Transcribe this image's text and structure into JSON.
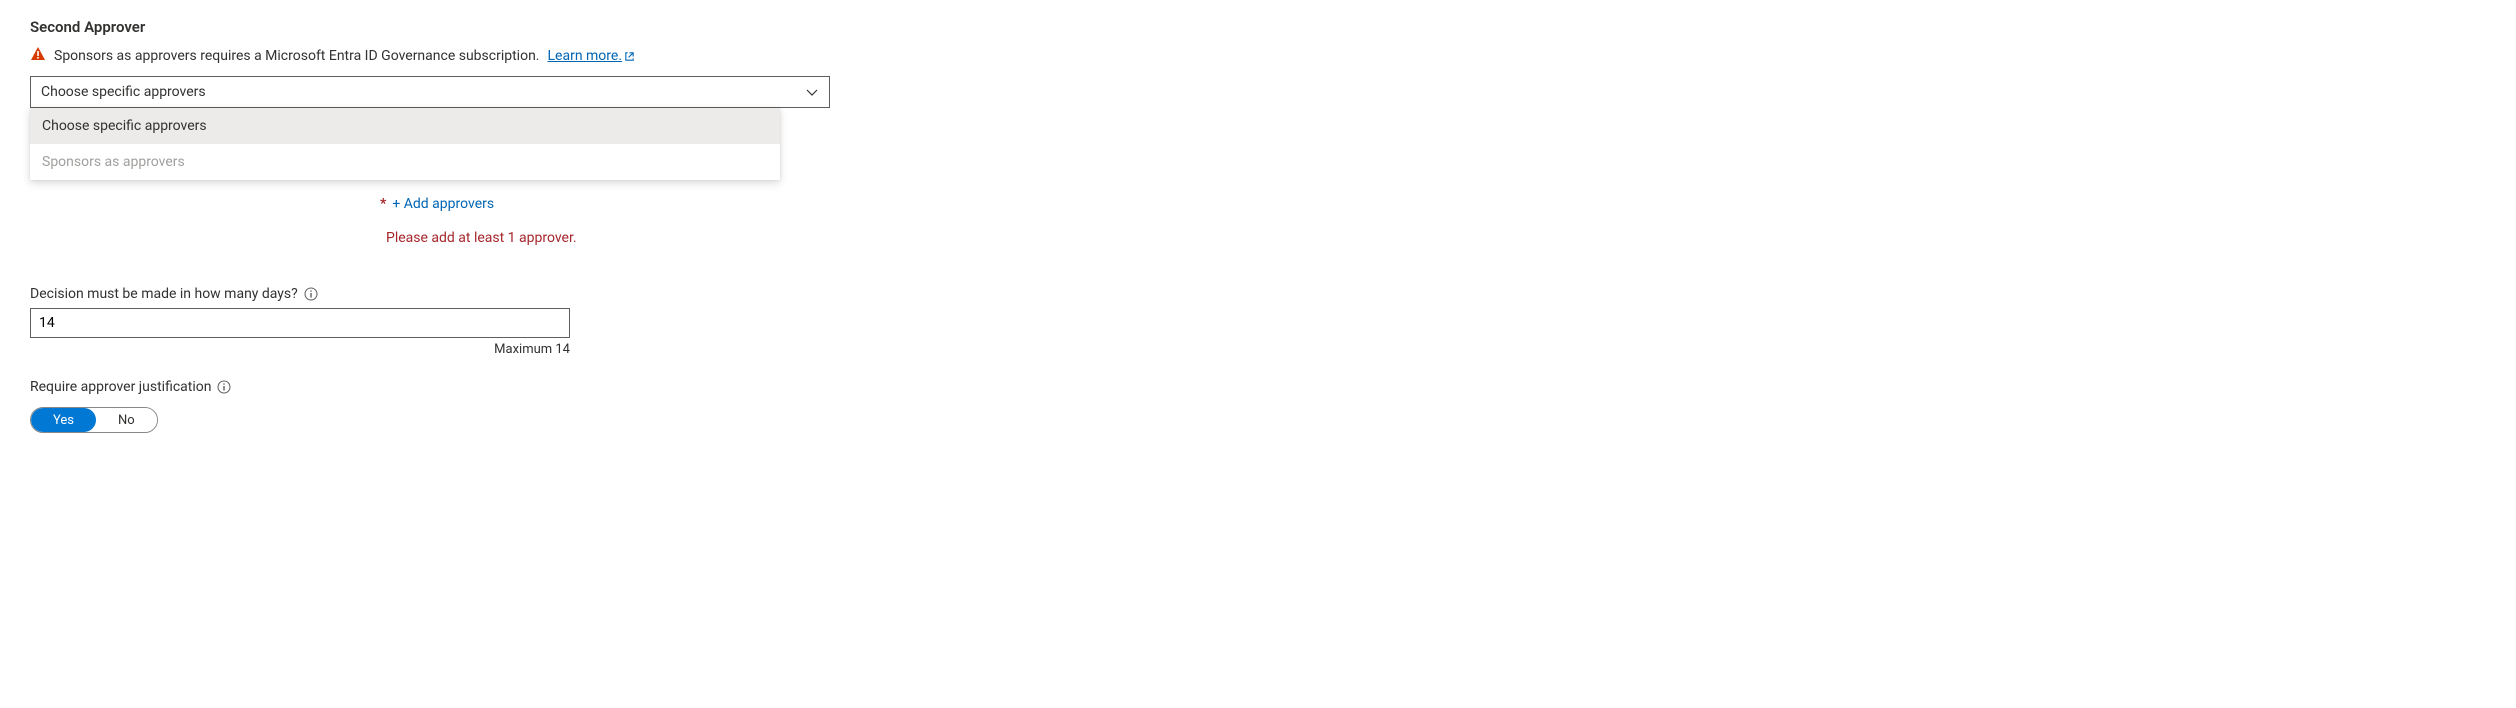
{
  "section": {
    "title": "Second Approver"
  },
  "infoBar": {
    "text": "Sponsors as approvers requires a Microsoft Entra ID Governance subscription.",
    "linkText": "Learn more."
  },
  "dropdown": {
    "selected": "Choose specific approvers",
    "options": {
      "opt1": "Choose specific approvers",
      "opt2": "Sponsors as approvers"
    }
  },
  "addApprovers": {
    "asterisk": "*",
    "label": "+ Add approvers"
  },
  "error": {
    "message": "Please add at least 1 approver."
  },
  "decisionDays": {
    "label": "Decision must be made in how many days?",
    "value": "14",
    "hint": "Maximum 14"
  },
  "justification": {
    "label": "Require approver justification",
    "yes": "Yes",
    "no": "No"
  }
}
